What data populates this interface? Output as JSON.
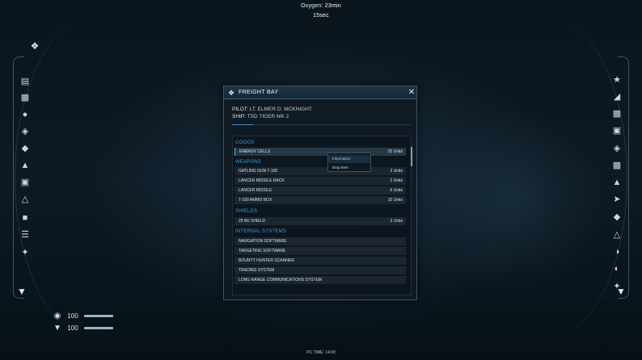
{
  "hud": {
    "oxygen_label": "Oxygen:",
    "oxygen_value": "23min 15sec",
    "pc_time": "PC TIME: 14:00",
    "health_value": "100",
    "shield_value": "100"
  },
  "panel": {
    "title": "FREIGHT BAY",
    "pilot_label": "PILOT:",
    "pilot_value": "LT. ELMER D. MCKNIGHT",
    "ship_label": "SHIP:",
    "ship_value": "TSD TIGER MK 2"
  },
  "cargo": {
    "goods_title": "GOODS",
    "goods": [
      {
        "name": "ENERGY CELLS",
        "qty": "25 Units"
      }
    ],
    "weapons_title": "WEAPONS",
    "weapons": [
      {
        "name": "GATLING GUN T-100",
        "qty": "2 Units"
      },
      {
        "name": "LANCER MISSILE RACK",
        "qty": "2 Units"
      },
      {
        "name": "LANCER MISSILE",
        "qty": "6 Units"
      },
      {
        "name": "T-100 AMMO BOX",
        "qty": "10 Units"
      }
    ],
    "shields_title": "SHIELDS",
    "shields": [
      {
        "name": "25 MJ SHIELD",
        "qty": "3 Units"
      }
    ],
    "internal_title": "INTERNAL SYSTEMS",
    "internal": [
      {
        "name": "NAVIGATION SOFTWARE",
        "qty": ""
      },
      {
        "name": "TARGETING SOFTWARE",
        "qty": ""
      },
      {
        "name": "BOUNTY HUNTER SCANNER",
        "qty": ""
      },
      {
        "name": "TRADING SYSTEM",
        "qty": ""
      },
      {
        "name": "LONG RANGE COMMUNICATIONS SYSTEM",
        "qty": ""
      }
    ]
  },
  "context_menu": {
    "items": [
      "Information",
      "Drop Item"
    ]
  },
  "icons": {
    "left_rail": [
      "document-icon",
      "clipboard-icon",
      "people-icon",
      "satellite-icon",
      "diamond-nav-icon",
      "hand-icon",
      "build-icon",
      "alert-icon",
      "medal-icon",
      "wrench-icon",
      "ladder-icon",
      "tool-icon"
    ],
    "right_rail": [
      "rank-icon",
      "stats-icon",
      "clipboard-icon",
      "cube-icon",
      "satellite-icon",
      "cargo-icon",
      "warning-icon",
      "rocket-icon",
      "drone-icon",
      "antenna-icon",
      "moon-icon",
      "globe-icon",
      "tools-icon"
    ]
  },
  "colors": {
    "accent": "#3f9ad6",
    "panel_bg": "#101a22",
    "selection": "#5fb0e6"
  }
}
